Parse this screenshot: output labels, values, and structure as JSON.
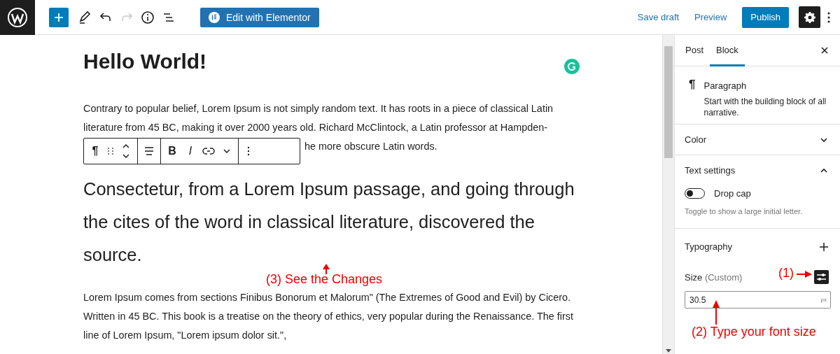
{
  "top_bar": {
    "redo_disabled": true,
    "elementor_button": "Edit with Elementor",
    "save_draft": "Save draft",
    "preview": "Preview",
    "publish": "Publish",
    "settings_open": true
  },
  "editor": {
    "title": "Hello World!",
    "paragraph": "Contrary to popular belief, Lorem Ipsum is not simply random text. It has roots in a piece of classical Latin literature from 45 BC, making it over 2000 years old. Richard McClintock, a Latin professor at Hampden-",
    "paragraph_visible_end": "he more obscure Latin words.",
    "block_toolbar": {
      "paragraph_glyph": "¶",
      "bold": "B",
      "italic": "I"
    },
    "large_paragraph": "Consectetur, from a Lorem Ipsum passage, and going through the cites of the word in classical literature, discovered the source.",
    "paragraph_2": "Lorem Ipsum comes from sections Finibus Bonorum et Malorum\" (The Extremes of Good and Evil) by Cicero. Written in 45 BC. This book is a treatise on the theory of ethics, very popular during the Renaissance. The first line of Lorem Ipsum, \"Lorem ipsum dolor sit.\","
  },
  "sidebar": {
    "tabs": [
      {
        "label": "Post",
        "selected": false
      },
      {
        "label": "Block",
        "selected": true
      }
    ],
    "block_card": {
      "icon": "¶",
      "title": "Paragraph",
      "description": "Start with the building block of all narrative."
    },
    "color_panel": {
      "title": "Color",
      "expanded": false
    },
    "text_settings": {
      "title": "Text settings",
      "expanded": true,
      "drop_cap": {
        "label": "Drop cap",
        "on": false,
        "help": "Toggle to show a large initial letter."
      }
    },
    "typography": {
      "title": "Typography",
      "size_label": "Size",
      "size_hint": "(Custom)",
      "size_value": "30.5",
      "unit": "px"
    }
  },
  "annotations": [
    {
      "label": "(1)"
    },
    {
      "label": "(2) Type your font size"
    },
    {
      "label": "(3) See the Changes"
    }
  ]
}
